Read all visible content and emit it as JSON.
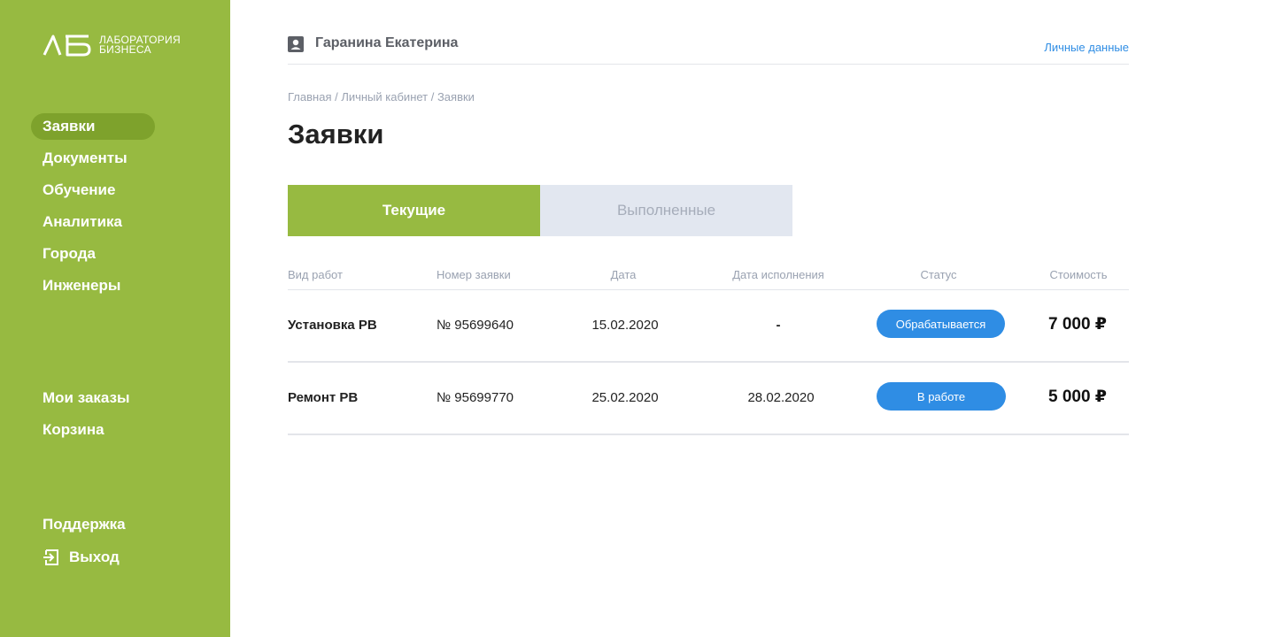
{
  "brand": {
    "logo_text_line1": "ЛАБОРАТОРИЯ",
    "logo_text_line2": "БИЗНЕСА",
    "primary_color": "#97ba41",
    "active_color": "#7ea22c",
    "accent_color": "#2f8de4"
  },
  "sidebar": {
    "items": [
      {
        "label": "Заявки",
        "active": true
      },
      {
        "label": "Документы"
      },
      {
        "label": "Обучение"
      },
      {
        "label": "Аналитика"
      },
      {
        "label": "Города"
      },
      {
        "label": "Инженеры"
      },
      {
        "label": "Мои заказы"
      },
      {
        "label": "Корзина"
      },
      {
        "label": "Поддержка"
      },
      {
        "label": "Выход",
        "icon": "exit-icon"
      }
    ]
  },
  "header": {
    "user_icon": "user-card-icon",
    "user_name": "Гаранина Екатерина",
    "personal_link": "Личные данные"
  },
  "breadcrumb": "Главная / Личный кабинет / Заявки",
  "page_title": "Заявки",
  "tabs": [
    {
      "label": "Текущие",
      "active": true
    },
    {
      "label": "Выполненные",
      "active": false
    }
  ],
  "table": {
    "columns": [
      "Вид работ",
      "Номер заявки",
      "Дата",
      "Дата исполнения",
      "Статус",
      "Стоимость"
    ],
    "rows": [
      {
        "work": "Установка РВ",
        "number": "№ 95699640",
        "date": "15.02.2020",
        "done_date": "-",
        "status": "Обрабатывается",
        "price": "7 000 ₽"
      },
      {
        "work": "Ремонт РВ",
        "number": "№ 95699770",
        "date": "25.02.2020",
        "done_date": "28.02.2020",
        "status": "В работе",
        "price": "5 000 ₽"
      }
    ]
  }
}
